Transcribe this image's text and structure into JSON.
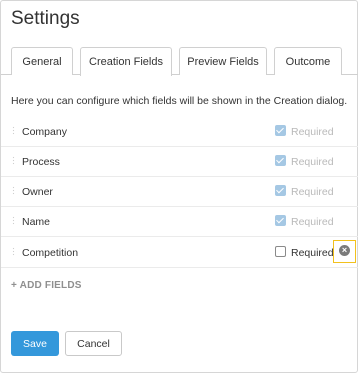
{
  "page": {
    "title": "Settings"
  },
  "tabs": [
    {
      "label": "General",
      "active": false
    },
    {
      "label": "Creation Fields",
      "active": true
    },
    {
      "label": "Preview Fields",
      "active": false
    },
    {
      "label": "Outcome",
      "active": false
    }
  ],
  "description": "Here you can configure which fields will be shown in the Creation dialog.",
  "fields": [
    {
      "label": "Company",
      "required_label": "Required",
      "required_checked": true,
      "required_disabled": true
    },
    {
      "label": "Process",
      "required_label": "Required",
      "required_checked": true,
      "required_disabled": true
    },
    {
      "label": "Owner",
      "required_label": "Required",
      "required_checked": true,
      "required_disabled": true
    },
    {
      "label": "Name",
      "required_label": "Required",
      "required_checked": true,
      "required_disabled": true
    },
    {
      "label": "Competition",
      "required_label": "Required",
      "required_checked": false,
      "required_disabled": false,
      "removable": true
    }
  ],
  "add_fields_label": "+ ADD FIELDS",
  "buttons": {
    "save": "Save",
    "cancel": "Cancel"
  },
  "colors": {
    "primary": "#3498db",
    "highlight": "#f2c11d",
    "checkbox_disabled": "#a5c8e4"
  },
  "icons": {
    "remove": "close-circle-icon",
    "drag": "drag-handle-icon"
  }
}
